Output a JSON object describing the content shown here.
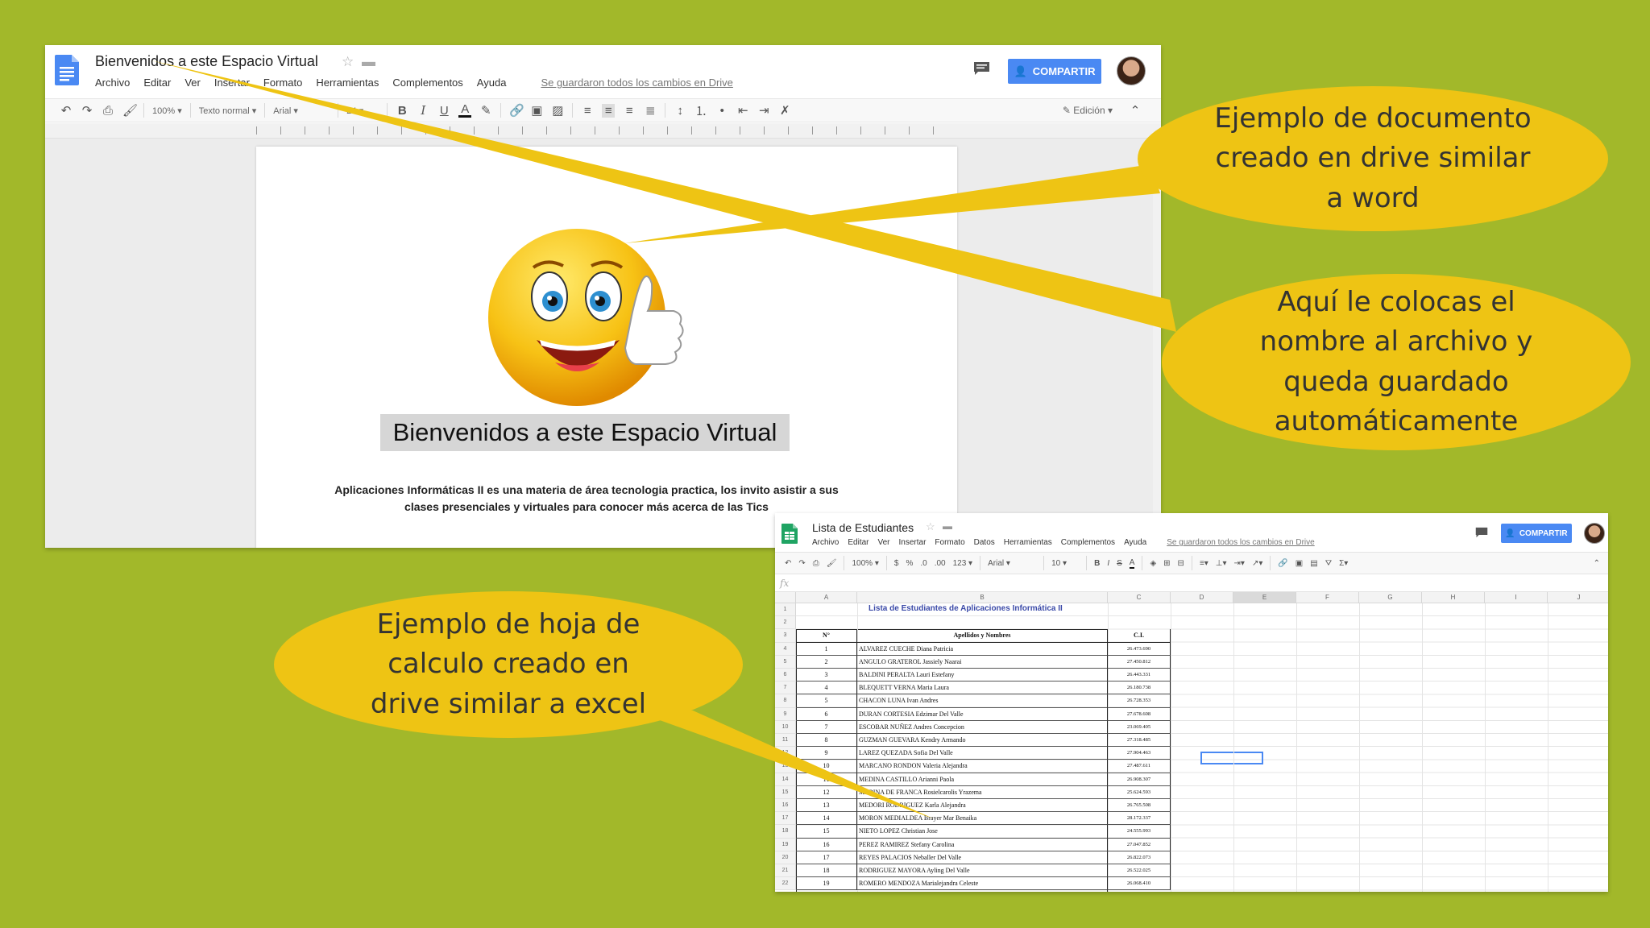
{
  "colors": {
    "background": "#a2b82a",
    "callout": "#eec414",
    "share_button": "#4a89f3",
    "sheet_title_color": "#3b4aa8"
  },
  "doc_window": {
    "title": "Bienvenidos a este Espacio Virtual",
    "menus": [
      "Archivo",
      "Editar",
      "Ver",
      "Insertar",
      "Formato",
      "Herramientas",
      "Complementos",
      "Ayuda"
    ],
    "save_status": "Se guardaron todos los cambios en Drive",
    "share_label": "COMPARTIR",
    "toolbar": {
      "zoom": "100%",
      "style": "Texto normal",
      "font": "Arial",
      "font_size": "24",
      "mode": "Edición"
    },
    "page": {
      "heading": "Bienvenidos a este Espacio Virtual",
      "body": "Aplicaciones Informáticas II es una materia de área tecnologia practica, los invito asistir a sus clases presenciales y virtuales para conocer más acerca de las Tics"
    }
  },
  "sheet_window": {
    "title": "Lista de Estudiantes",
    "menus": [
      "Archivo",
      "Editar",
      "Ver",
      "Insertar",
      "Formato",
      "Datos",
      "Herramientas",
      "Complementos",
      "Ayuda"
    ],
    "save_status": "Se guardaron todos los cambios en Drive",
    "share_label": "COMPARTIR",
    "toolbar": {
      "zoom": "100%",
      "currency": "$",
      "percent": "%",
      "decimals_less": ".0",
      "decimals_more": ".00",
      "format": "123",
      "font": "Arial",
      "font_size": "10"
    },
    "fx": "fx",
    "columns": [
      "A",
      "B",
      "C",
      "D",
      "E",
      "F",
      "G",
      "H",
      "I",
      "J"
    ],
    "row_numbers": [
      "1",
      "2",
      "3",
      "4",
      "5",
      "6",
      "7",
      "8",
      "9",
      "10",
      "11",
      "12",
      "13",
      "14",
      "15",
      "16",
      "17",
      "18",
      "19",
      "20",
      "21",
      "22"
    ],
    "list_title": "Lista de Estudiantes de Aplicaciones Informática II",
    "table_headers": [
      "N°",
      "Apellidos y Nombres",
      "C.I."
    ],
    "students": [
      {
        "n": "1",
        "name": "ALVAREZ CUECHE Diana Patricia",
        "ci": "26.473.690"
      },
      {
        "n": "2",
        "name": "ANGULO GRATEROL Jassiely Naarai",
        "ci": "27.450.812"
      },
      {
        "n": "3",
        "name": "BALDINI PERALTA Lauri Estefany",
        "ci": "26.443.331"
      },
      {
        "n": "4",
        "name": "BLEQUETT VERNA Maria Laura",
        "ci": "26.180.738"
      },
      {
        "n": "5",
        "name": "CHACON LUNA Ivan Andres",
        "ci": "26.728.353"
      },
      {
        "n": "6",
        "name": "DURAN CORTESIA Edzimar Del Valle",
        "ci": "27.678.608"
      },
      {
        "n": "7",
        "name": "ESCOBAR NUÑEZ Andres Concepcion",
        "ci": "23.069.405"
      },
      {
        "n": "8",
        "name": "GUZMAN GUEVARA Kendry Armando",
        "ci": "27.318.485"
      },
      {
        "n": "9",
        "name": "LAREZ QUEZADA Sofia Del Valle",
        "ci": "27.904.463"
      },
      {
        "n": "10",
        "name": "MARCANO RONDON Valeria Alejandra",
        "ci": "27.487.611"
      },
      {
        "n": "11",
        "name": "MEDINA CASTILLO Arianni Paola",
        "ci": "26.908.307"
      },
      {
        "n": "12",
        "name": "MEDINA DE FRANCA Rosielcarolis Yrazema",
        "ci": "25.624.593"
      },
      {
        "n": "13",
        "name": "MEDORI RODRIGUEZ Karla Alejandra",
        "ci": "26.765.508"
      },
      {
        "n": "14",
        "name": "MORON MEDIALDEA Brayer Mar Benaika",
        "ci": "28.172.337"
      },
      {
        "n": "15",
        "name": "NIETO LOPEZ Christian Jose",
        "ci": "24.555.993"
      },
      {
        "n": "16",
        "name": "PEREZ RAMIREZ Stefany Carolina",
        "ci": "27.047.852"
      },
      {
        "n": "17",
        "name": "REYES PALACIOS Neballer Del Valle",
        "ci": "26.822.073"
      },
      {
        "n": "18",
        "name": "RODRIGUEZ MAYORA Ayling Del Valle",
        "ci": "26.522.025"
      },
      {
        "n": "19",
        "name": "ROMERO MENDOZA Marialejandra Celeste",
        "ci": "26.068.410"
      }
    ]
  },
  "callouts": {
    "doc_example": "Ejemplo de documento creado en drive similar a word",
    "rename_tip": "Aquí le colocas el nombre al archivo y queda guardado automáticamente",
    "sheet_example": "Ejemplo de hoja de calculo creado en drive similar a excel"
  }
}
